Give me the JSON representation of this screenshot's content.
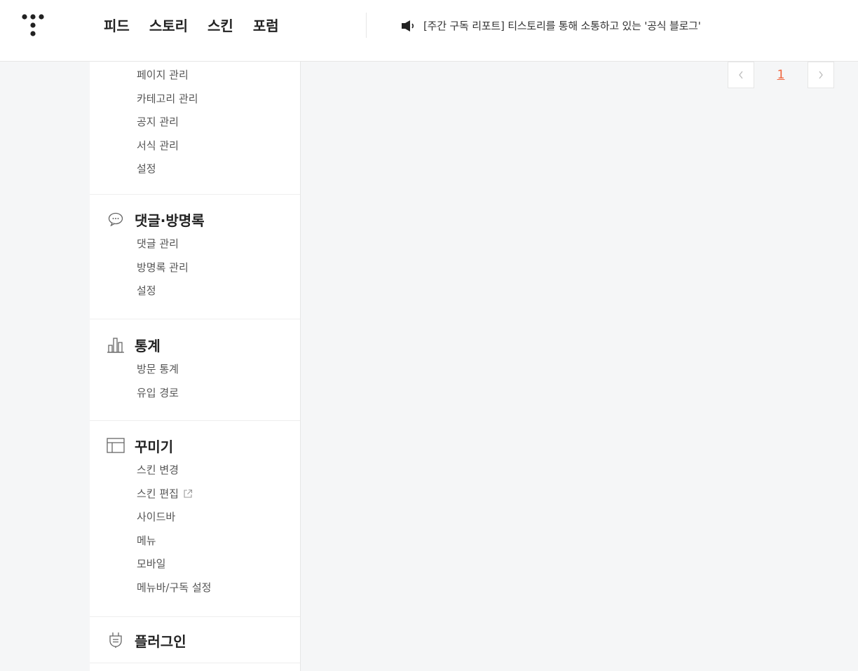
{
  "header": {
    "nav": [
      "피드",
      "스토리",
      "스킨",
      "포럼"
    ],
    "notice_text": "[주간 구독 리포트] 티스토리를 통해 소통하고 있는 '공식 블로그'"
  },
  "sidebar": {
    "content_items": [
      "페이지 관리",
      "카테고리 관리",
      "공지 관리",
      "서식 관리",
      "설정"
    ],
    "comments": {
      "title": "댓글·방명록",
      "icon": "comment-icon",
      "items": [
        "댓글 관리",
        "방명록 관리",
        "설정"
      ]
    },
    "stats": {
      "title": "통계",
      "icon": "bar-chart-icon",
      "items": [
        "방문 통계",
        "유입 경로"
      ]
    },
    "design": {
      "title": "꾸미기",
      "icon": "layout-icon",
      "items": [
        "스킨 변경",
        "스킨 편집",
        "사이드바",
        "메뉴",
        "모바일",
        "메뉴바/구독 설정"
      ]
    },
    "plugin": {
      "title": "플러그인",
      "icon": "plug-icon"
    }
  },
  "pagination": {
    "current_page": "1",
    "accent": "#f0643c"
  }
}
